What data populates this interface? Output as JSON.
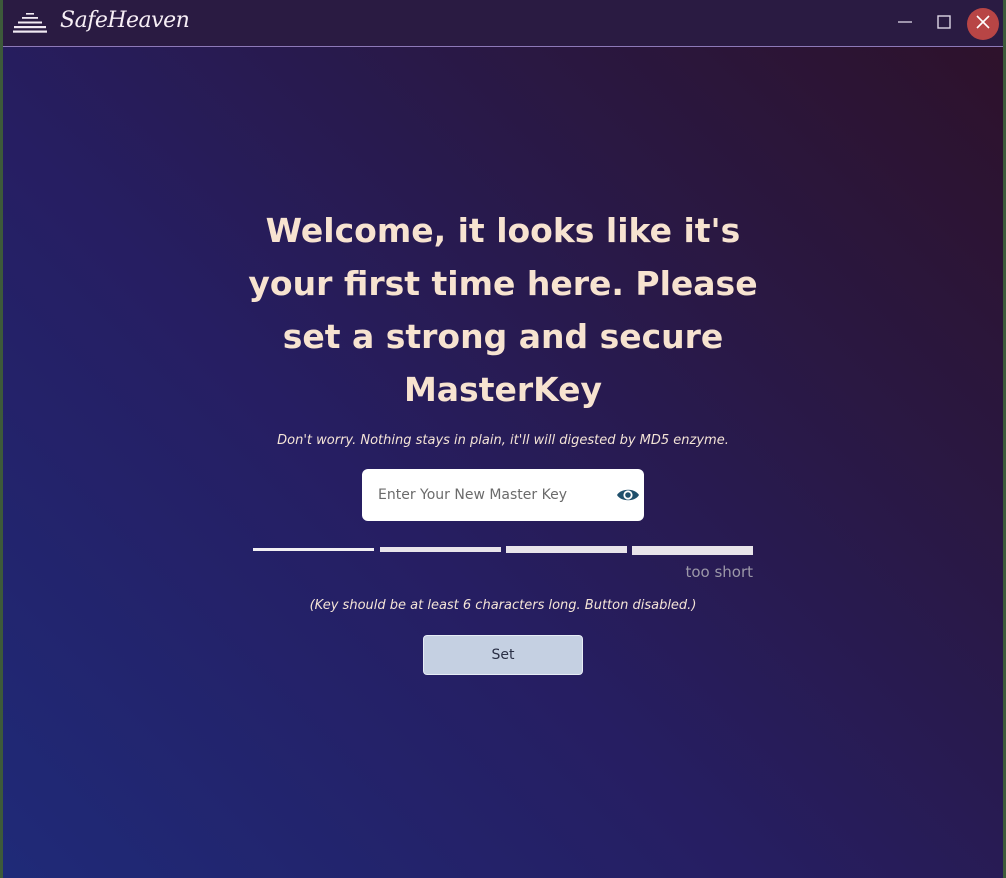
{
  "titlebar": {
    "app_name": "SafeHeaven",
    "icons": {
      "logo": "stacked-lines-logo-icon",
      "minimize": "minimize-icon",
      "maximize": "maximize-icon",
      "close": "close-icon"
    },
    "colors": {
      "close_bg": "#b84545"
    }
  },
  "main": {
    "heading": "Welcome, it looks like it's your first time here. Please set a strong and secure MasterKey",
    "subtext": "Don't worry. Nothing stays in plain, it'll will digested by MD5 enzyme.",
    "key_input": {
      "value": "",
      "placeholder": "Enter Your New Master Key",
      "toggle_icon": "eye-icon"
    },
    "strength": {
      "segments": 4,
      "label": "too short"
    },
    "hint": "(Key should be at least 6 characters long. Button disabled.)",
    "set_button": {
      "label": "Set",
      "disabled": true
    }
  },
  "colors": {
    "heading": "#f7e3d0",
    "button_bg": "#c5d0e2",
    "gradient_start": "#1f2a78",
    "gradient_end": "#2e1129"
  }
}
